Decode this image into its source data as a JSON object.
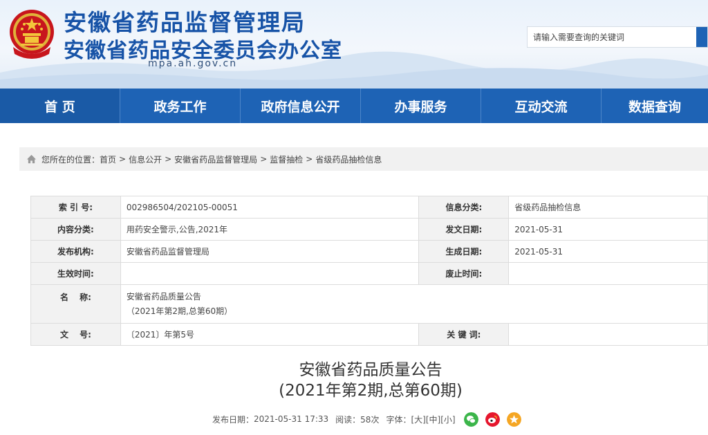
{
  "header": {
    "title_main": "安徽省药品监督管理局",
    "title_sub": "安徽省药品安全委员会办公室",
    "domain": "mpa.ah.gov.cn",
    "search": {
      "placeholder": "请输入需要查询的关键词"
    }
  },
  "nav": {
    "items": [
      "首 页",
      "政务工作",
      "政府信息公开",
      "办事服务",
      "互动交流",
      "数据查询"
    ]
  },
  "breadcrumb": {
    "prefix": "您所在的位置：",
    "items": [
      "首页",
      "信息公开",
      "安徽省药品监督管理局",
      "监督抽检",
      "省级药品抽检信息"
    ],
    "separator": ">"
  },
  "info": {
    "index_label": "索 引 号:",
    "index_value": "002986504/202105-00051",
    "info_cat_label": "信息分类:",
    "info_cat_value": "省级药品抽检信息",
    "content_cat_label": "内容分类:",
    "content_cat_value": "用药安全警示,公告,2021年",
    "issue_date_label": "发文日期:",
    "issue_date_value": "2021-05-31",
    "publisher_label": "发布机构:",
    "publisher_value": "安徽省药品监督管理局",
    "created_date_label": "生成日期:",
    "created_date_value": "2021-05-31",
    "effective_label": "生效时间:",
    "effective_value": "",
    "abolish_label": "废止时间:",
    "abolish_value": "",
    "name_label": "名　 称:",
    "name_line1": "安徽省药品质量公告",
    "name_line2": "（2021年第2期,总第60期）",
    "doc_no_label": "文　 号:",
    "doc_no_value": "〔2021〕年第5号",
    "keywords_label": "关 键 词:",
    "keywords_value": ""
  },
  "article": {
    "title_line1": "安徽省药品质量公告",
    "title_line2": "(2021年第2期,总第60期)",
    "publish_label": "发布日期：",
    "publish_value": "2021-05-31 17:33",
    "views_label": "阅读：",
    "views_value": "58次",
    "font_label": "字体：",
    "font_large": "[大]",
    "font_medium": "[中]",
    "font_small": "[小]"
  },
  "share": {
    "wechat_color": "#3bb54a",
    "weibo_color": "#e6162d",
    "favorite_color": "#f5a623"
  }
}
